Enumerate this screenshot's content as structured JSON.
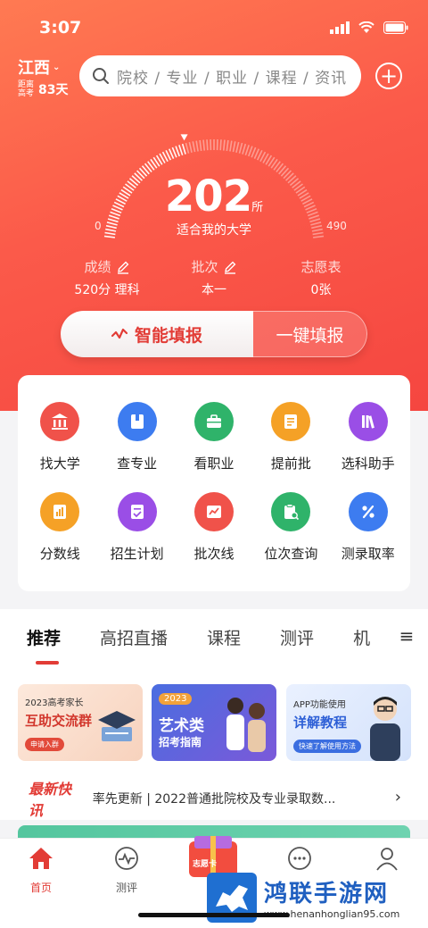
{
  "status": {
    "time": "3:07"
  },
  "header": {
    "province": "江西",
    "countdown_prefix": "距离高考",
    "countdown_days": "83天",
    "search_placeholder": "院校 / 专业 / 职业 / 课程 / 资讯"
  },
  "gauge": {
    "count": "202",
    "unit": "所",
    "label": "适合我的大学",
    "min": "0",
    "max": "490",
    "fraction": 0.41
  },
  "stats": [
    {
      "title": "成绩",
      "value": "520分 理科"
    },
    {
      "title": "批次",
      "value": "本一"
    },
    {
      "title": "志愿表",
      "value": "0张"
    }
  ],
  "actions": {
    "smart_fill": "智能填报",
    "one_click_fill": "一键填报"
  },
  "grid": [
    {
      "label": "找大学",
      "icon": "bank-icon",
      "color": "#f0524a"
    },
    {
      "label": "查专业",
      "icon": "book-icon",
      "color": "#3d7cf0"
    },
    {
      "label": "看职业",
      "icon": "briefcase-icon",
      "color": "#2fb36a"
    },
    {
      "label": "提前批",
      "icon": "list-icon",
      "color": "#f5a126"
    },
    {
      "label": "选科助手",
      "icon": "books-icon",
      "color": "#9a4ee6"
    },
    {
      "label": "分数线",
      "icon": "bar-chart-icon",
      "color": "#f5a126"
    },
    {
      "label": "招生计划",
      "icon": "document-check-icon",
      "color": "#9a4ee6"
    },
    {
      "label": "批次线",
      "icon": "line-chart-icon",
      "color": "#f0524a"
    },
    {
      "label": "位次查询",
      "icon": "clipboard-search-icon",
      "color": "#2fb36a"
    },
    {
      "label": "测录取率",
      "icon": "percent-icon",
      "color": "#3d7cf0"
    }
  ],
  "tabs": [
    "推荐",
    "高招直播",
    "课程",
    "测评",
    "机"
  ],
  "banners": [
    {
      "line1": "2023高考家长",
      "line2": "互助交流群",
      "button": "申请入群"
    },
    {
      "badge": "2023",
      "line1": "艺术类",
      "line2": "招考指南"
    },
    {
      "line1": "APP功能使用",
      "line2": "详解教程",
      "button": "快速了解使用方法"
    }
  ],
  "news": {
    "tag": "最新快讯",
    "text": "率先更新 | 2022普通批院校及专业录取数..."
  },
  "bottom_nav": [
    {
      "label": "首页",
      "icon": "home-icon"
    },
    {
      "label": "测评",
      "icon": "pulse-icon"
    },
    {
      "label": "志愿卡",
      "icon": "card-icon"
    },
    {
      "label": "",
      "icon": "chat-icon"
    },
    {
      "label": "",
      "icon": "user-icon"
    }
  ],
  "watermark": {
    "title": "鸿联手游网",
    "url": "www.henanhonglian95.com"
  },
  "colors": {
    "accent": "#e23c36",
    "hero_start": "#ff7a52",
    "hero_end": "#f54640"
  }
}
